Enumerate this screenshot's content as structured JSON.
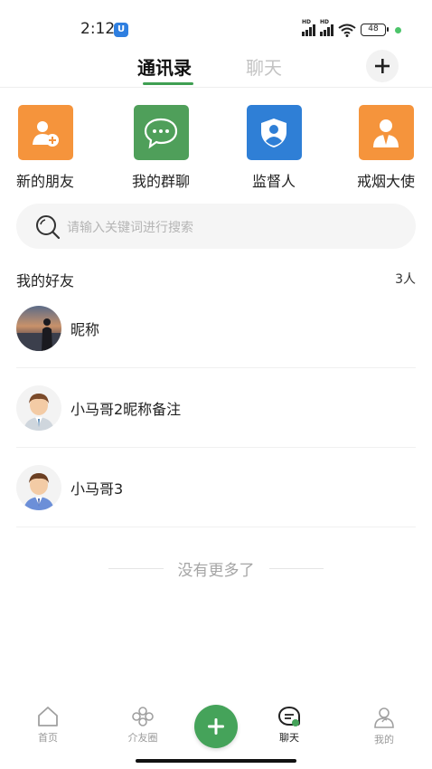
{
  "status_bar": {
    "time": "2:12",
    "app_badge": "U",
    "signal_label": "HD",
    "battery": "48"
  },
  "tabs": {
    "active": "通讯录",
    "inactive": "聊天"
  },
  "quick_actions": [
    {
      "label": "新的朋友",
      "color": "#f5943c",
      "icon": "add-friend-icon"
    },
    {
      "label": "我的群聊",
      "color": "#4f9f5a",
      "icon": "chat-bubble-icon"
    },
    {
      "label": "监督人",
      "color": "#2f7fd6",
      "icon": "shield-user-icon"
    },
    {
      "label": "戒烟大使",
      "color": "#f5943c",
      "icon": "person-suit-icon"
    }
  ],
  "search": {
    "placeholder": "请输入关键词进行搜索"
  },
  "friends_section": {
    "title": "我的好友",
    "count": "3人"
  },
  "friends": [
    {
      "name": "昵称",
      "avatar": "photo-avatar"
    },
    {
      "name": "小马哥2昵称备注",
      "avatar": "cartoon-man-avatar"
    },
    {
      "name": "小马哥3",
      "avatar": "cartoon-man-avatar"
    }
  ],
  "footer_text": "没有更多了",
  "bottom_nav": {
    "home": "首页",
    "moments": "介友圈",
    "chat": "聊天",
    "mine": "我的"
  },
  "colors": {
    "accent": "#45a35a",
    "underline": "#3f9f52"
  }
}
